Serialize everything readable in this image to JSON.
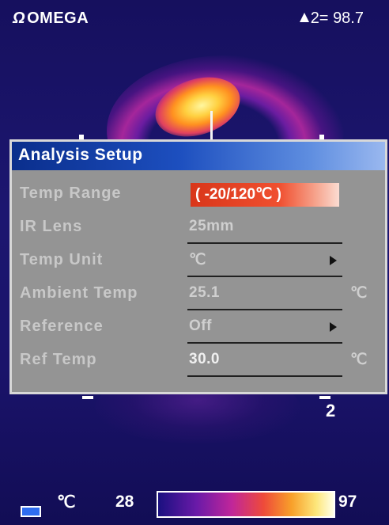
{
  "header": {
    "brand_symbol": "Ω",
    "brand_name": "OMEGA",
    "marker_label": "2=",
    "marker_value": "98.7",
    "marker_icon": "triangle-up-icon"
  },
  "viewport": {
    "cursor_label": "2"
  },
  "dialog": {
    "title": "Analysis Setup",
    "rows": [
      {
        "label": "Temp Range",
        "value": "( -20/120℃ )",
        "control": "highlighted-field"
      },
      {
        "label": "IR Lens",
        "value": "25mm",
        "control": "text"
      },
      {
        "label": "Temp Unit",
        "value": "℃",
        "control": "select"
      },
      {
        "label": "Ambient Temp",
        "value": "25.1",
        "unit": "℃",
        "control": "input"
      },
      {
        "label": "Reference",
        "value": "Off",
        "control": "select"
      },
      {
        "label": "Ref Temp",
        "value": "30.0",
        "unit": "℃",
        "control": "input"
      }
    ]
  },
  "footer": {
    "battery_icon": "battery-icon",
    "unit": "℃",
    "scale_min": "28",
    "scale_max": "97"
  },
  "colors": {
    "title_bar": "#1d4fbf",
    "dialog_bg": "#949494",
    "highlight": "#f05030",
    "background": "#1a1466"
  }
}
